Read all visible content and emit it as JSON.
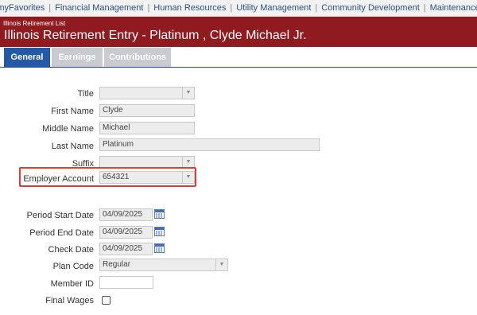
{
  "topnav": {
    "items": [
      "myFavorites",
      "Financial Management",
      "Human Resources",
      "Utility Management",
      "Community Development",
      "Maintenance"
    ],
    "separator": "|"
  },
  "header": {
    "breadcrumb": "Illinois Retirement List",
    "title": "Illinois Retirement Entry - Platinum , Clyde Michael Jr."
  },
  "tabs": [
    "General",
    "Earnings",
    "Contributions"
  ],
  "form": {
    "title_label": "Title",
    "title_value": "",
    "first_name_label": "First Name",
    "first_name_value": "Clyde",
    "middle_name_label": "Middle Name",
    "middle_name_value": "Michael",
    "last_name_label": "Last Name",
    "last_name_value": "Platinum",
    "suffix_label": "Suffix",
    "suffix_value": "",
    "employer_account_label": "Employer Account",
    "employer_account_value": "654321",
    "period_start_label": "Period Start Date",
    "period_start_value": "04/09/2025",
    "period_end_label": "Period End Date",
    "period_end_value": "04/09/2025",
    "check_date_label": "Check Date",
    "check_date_value": "04/09/2025",
    "plan_code_label": "Plan Code",
    "plan_code_value": "Regular",
    "member_id_label": "Member ID",
    "member_id_value": "",
    "final_wages_label": "Final Wages",
    "final_wages_checked": false
  },
  "colors": {
    "header_bg": "#8f1a1f",
    "tab_active": "#2459a8",
    "tab_inactive": "#c8ccd1",
    "nav_link": "#2a4f8a",
    "highlight": "#e03a3a"
  },
  "icons": {
    "dropdown": "chevron-down-icon",
    "calendar": "calendar-icon",
    "checkbox": "checkbox-icon"
  }
}
